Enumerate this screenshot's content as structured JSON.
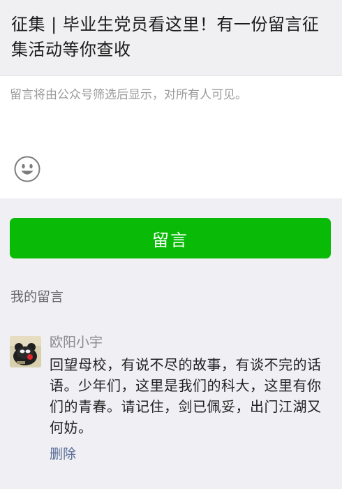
{
  "article": {
    "title": "征集 | 毕业生党员看这里！有一份留言征集活动等你查收"
  },
  "compose": {
    "placeholder": "留言将由公众号筛选后显示，对所有人可见。",
    "emoji_icon": "smiley-face-icon"
  },
  "submit": {
    "label": "留言"
  },
  "my_comments": {
    "section_title": "我的留言",
    "items": [
      {
        "nickname": "欧阳小宇",
        "content": "回望母校，有说不尽的故事，有谈不完的话语。少年们，这里是我们的科大，这里有你们的青春。请记住，剑已佩妥，出门江湖又何妨。",
        "delete_label": "删除"
      }
    ]
  },
  "colors": {
    "accent_green": "#09bb07",
    "link_blue": "#576b95",
    "page_bg": "#efeff4"
  }
}
